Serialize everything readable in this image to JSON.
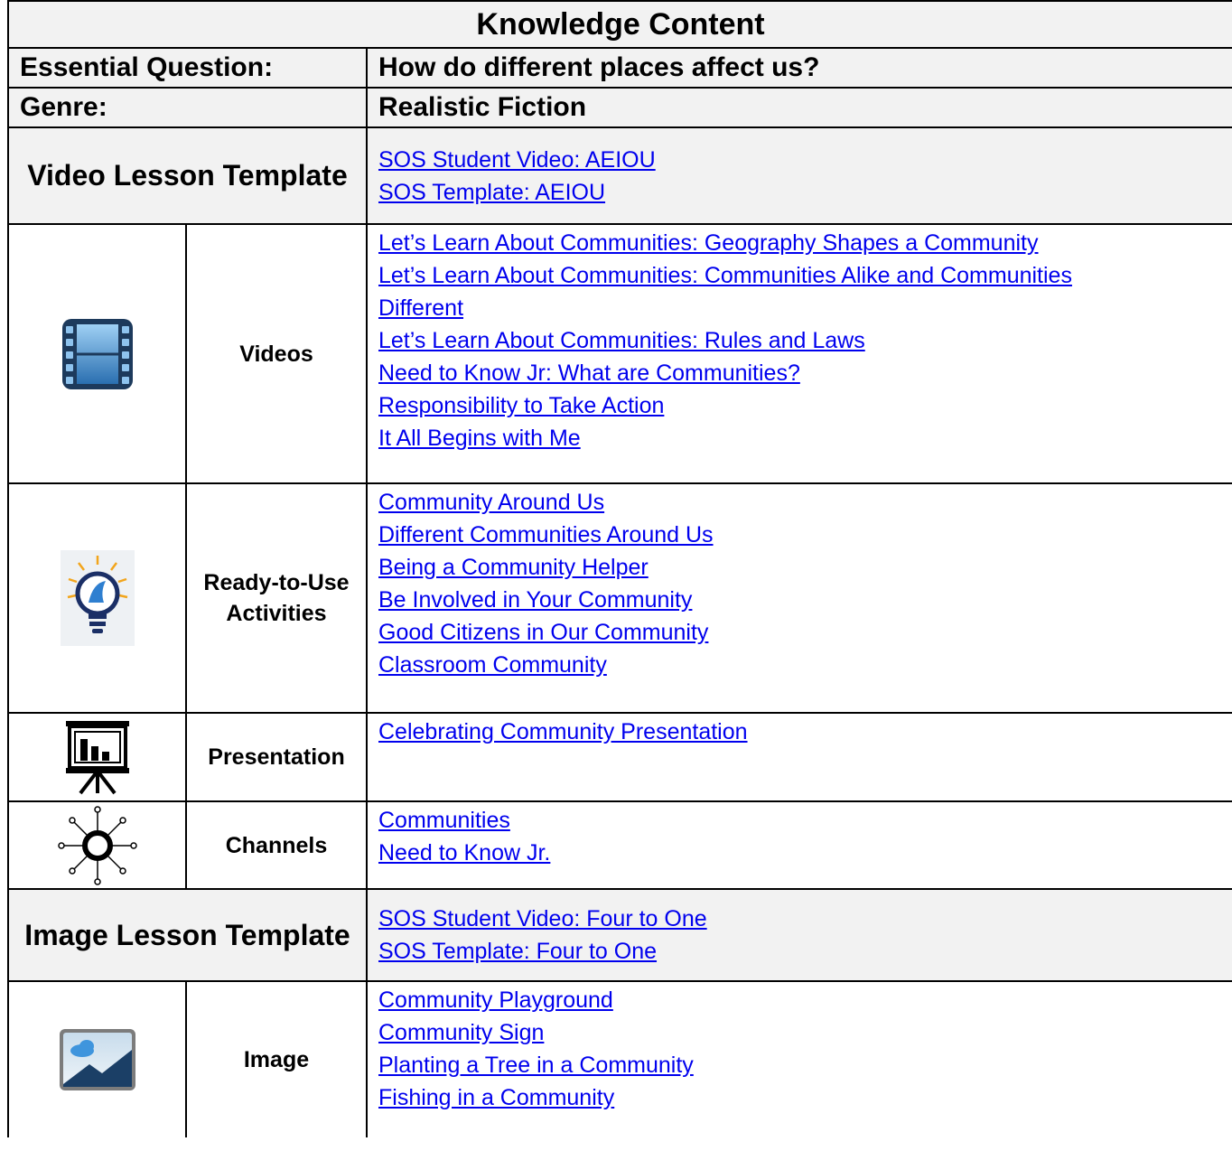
{
  "title": "Knowledge Content",
  "essential_question": {
    "label": "Essential Question:",
    "value": "How do different places affect us?"
  },
  "genre": {
    "label": "Genre:",
    "value": "Realistic Fiction"
  },
  "video_lesson": {
    "label": "Video Lesson Template",
    "links": [
      "SOS Student Video:  AEIOU",
      "SOS Template:  AEIOU"
    ]
  },
  "videos": {
    "label": "Videos",
    "icon": "film-icon",
    "links": [
      "Let’s Learn About Communities:  Geography Shapes a Community",
      "Let’s Learn About Communities:  Communities Alike and Communities",
      "Different",
      "Let’s Learn About Communities:  Rules and Laws",
      "Need to Know Jr:  What are Communities?",
      "Responsibility to Take Action",
      "It All Begins with Me"
    ]
  },
  "activities": {
    "label_line1": "Ready-to-Use",
    "label_line2": "Activities",
    "icon": "lightbulb-icon",
    "links": [
      "Community Around Us",
      "Different Communities Around Us",
      "Being a Community Helper",
      "Be Involved in Your Community",
      "Good Citizens in Our Community",
      "Classroom Community"
    ]
  },
  "presentation": {
    "label": "Presentation",
    "icon": "presentation-board-icon",
    "links": [
      "Celebrating Community Presentation"
    ]
  },
  "channels": {
    "label": "Channels",
    "icon": "channels-hub-icon",
    "links": [
      "Communities",
      "Need to Know Jr."
    ]
  },
  "image_lesson": {
    "label": "Image Lesson Template",
    "links": [
      "SOS Student Video:  Four to One",
      "SOS Template:  Four to One"
    ]
  },
  "image": {
    "label": "Image",
    "icon": "image-icon",
    "links": [
      "Community Playground",
      "Community Sign",
      "Planting a Tree in a Community",
      "Fishing in a Community"
    ]
  },
  "colors": {
    "link": "#0000ee",
    "shade": "#f2f2f2",
    "border": "#000000"
  }
}
